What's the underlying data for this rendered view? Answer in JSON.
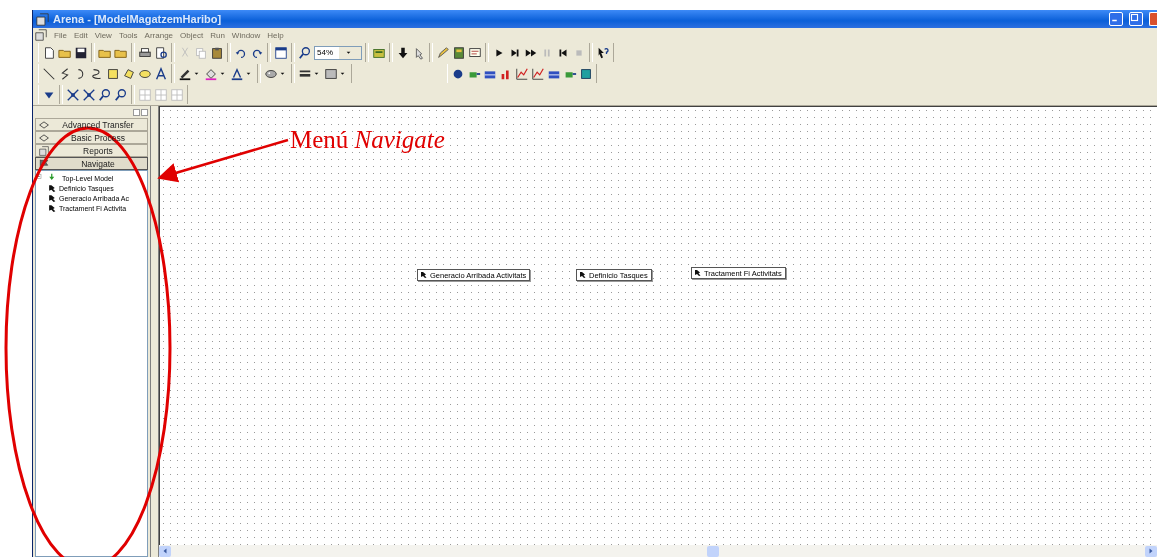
{
  "window": {
    "title": "Arena - [ModelMagatzemHaribo]"
  },
  "menu": [
    "File",
    "Edit",
    "View",
    "Tools",
    "Arrange",
    "Object",
    "Run",
    "Window",
    "Help"
  ],
  "toolbar": {
    "zoom": "54%"
  },
  "project_bar": {
    "panels": [
      {
        "label": "Advanced Transfer",
        "selected": false
      },
      {
        "label": "Basic Process",
        "selected": false
      },
      {
        "label": "Reports",
        "selected": false
      },
      {
        "label": "Navigate",
        "selected": true
      }
    ],
    "tree": [
      {
        "label": "Top-Level Model",
        "expanded": true,
        "children": [
          {
            "label": "Definicio Tasques"
          },
          {
            "label": "Generacio Arribada Ac"
          },
          {
            "label": "Tractament Fi Activita"
          }
        ]
      }
    ]
  },
  "canvas": {
    "submodels": [
      {
        "label": "Generacio Arribada Activitats"
      },
      {
        "label": "Definicio Tasques"
      },
      {
        "label": "Tractament Fi Activitats"
      }
    ]
  },
  "annotation": {
    "label": "Menú *Navigate*"
  }
}
